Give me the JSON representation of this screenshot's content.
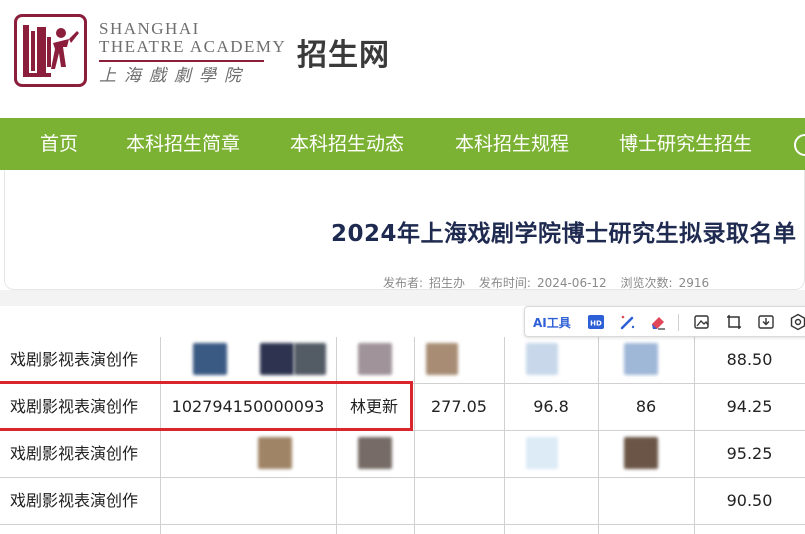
{
  "header": {
    "logo_en_line1": "SHANGHAI",
    "logo_en_line2": "THEATRE ACADEMY",
    "logo_cn": "上海戲劇學院",
    "site_name": "招生网"
  },
  "nav": {
    "items": [
      "首页",
      "本科招生简章",
      "本科招生动态",
      "本科招生规程",
      "博士研究生招生"
    ]
  },
  "article": {
    "title": "2024年上海戏剧学院博士研究生拟录取名单",
    "publisher_label": "发布者:",
    "publisher": "招生办",
    "time_label": "发布时间:",
    "time": "2024-06-12",
    "views_label": "浏览次数:",
    "views": "2916"
  },
  "toolbar": {
    "ai_label": "AI工具",
    "icons": [
      "hd-icon",
      "magic-wand-icon",
      "eraser-icon",
      "image-edit-icon",
      "crop-icon",
      "download-icon",
      "settings-icon"
    ]
  },
  "table": {
    "rows": [
      {
        "major": "戏剧影视表演创作",
        "id": "",
        "name": "",
        "score1": "",
        "score2": "",
        "score3": "",
        "total": "88.50"
      },
      {
        "major": "戏剧影视表演创作",
        "id": "102794150000093",
        "name": "林更新",
        "score1": "277.05",
        "score2": "96.8",
        "score3": "86",
        "total": "94.25"
      },
      {
        "major": "戏剧影视表演创作",
        "id": "",
        "name": "",
        "score1": "",
        "score2": "",
        "score3": "",
        "total": "95.25"
      },
      {
        "major": "戏剧影视表演创作",
        "id": "",
        "name": "",
        "score1": "",
        "score2": "",
        "score3": "",
        "total": "90.50"
      }
    ]
  },
  "colors": {
    "nav_green": "#7cb234",
    "brand_maroon": "#8a1e3b",
    "highlight_red": "#d9262c",
    "title_navy": "#1f2a50"
  }
}
